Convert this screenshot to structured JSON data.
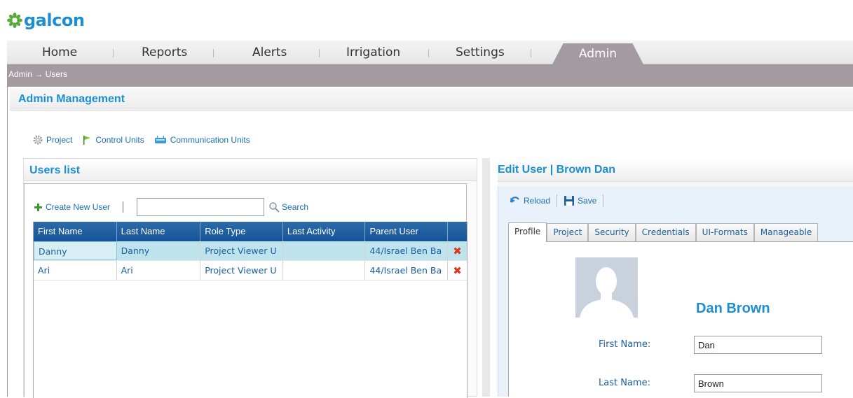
{
  "brand": {
    "name": "galcon",
    "color": "#1d8fd0"
  },
  "nav": {
    "items": [
      "Home",
      "Reports",
      "Alerts",
      "Irrigation",
      "Settings"
    ],
    "active": "Admin"
  },
  "breadcrumb": {
    "text": "Admin → Users"
  },
  "admin": {
    "title": "Admin Management",
    "links": [
      {
        "label": "Project",
        "icon": "gear-icon"
      },
      {
        "label": "Control Units",
        "icon": "flag-icon"
      },
      {
        "label": "Communication Units",
        "icon": "modem-icon"
      }
    ]
  },
  "users_list": {
    "title": "Users list",
    "create_label": "Create New User",
    "search_label": "Search",
    "search_value": "",
    "columns": [
      "First Name",
      "Last Name",
      "Role Type",
      "Last Activity",
      "Parent User"
    ],
    "rows": [
      {
        "first": "Danny",
        "last": "Danny",
        "role": "Project Viewer U",
        "activity": "",
        "parent": "44/Israel Ben Ba",
        "selected": true
      },
      {
        "first": "Ari",
        "last": "Ari",
        "role": "Project Viewer U",
        "activity": "",
        "parent": "44/Israel Ben Ba",
        "selected": false
      }
    ]
  },
  "edit_user": {
    "title": "Edit User | Brown Dan",
    "reload_label": "Reload",
    "save_label": "Save",
    "tabs": [
      "Profile",
      "Project",
      "Security",
      "Credentials",
      "UI-Formats",
      "Manageable"
    ],
    "active_tab": "Profile",
    "display_name": "Dan  Brown",
    "first_name_label": "First Name:",
    "first_name_value": "Dan",
    "last_name_label": "Last Name:",
    "last_name_value": "Brown"
  }
}
